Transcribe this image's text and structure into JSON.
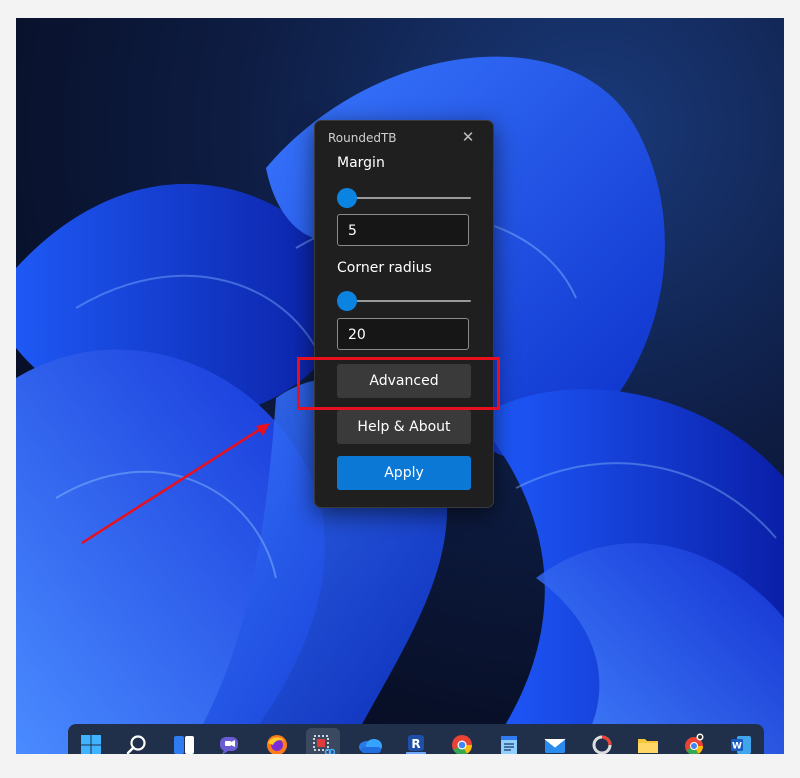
{
  "dialog": {
    "title": "RoundedTB",
    "close_icon": "close-icon",
    "margin_label": "Margin",
    "margin_value": "5",
    "margin_slider_fraction": 0.0,
    "corner_label": "Corner radius",
    "corner_value": "20",
    "corner_slider_fraction": 0.0,
    "advanced_label": "Advanced",
    "help_label": "Help & About",
    "apply_label": "Apply"
  },
  "colors": {
    "accent": "#0a78d4",
    "highlight": "#e8101f",
    "dialog_bg": "#1f1f1f"
  },
  "taskbar": {
    "icons": [
      {
        "name": "start-windows-icon"
      },
      {
        "name": "search-icon"
      },
      {
        "name": "widgets-icon"
      },
      {
        "name": "teams-chat-icon"
      },
      {
        "name": "firefox-icon"
      },
      {
        "name": "snipping-tool-icon",
        "active": true
      },
      {
        "name": "onedrive-icon"
      },
      {
        "name": "roundedtb-app-icon"
      },
      {
        "name": "chrome-icon"
      },
      {
        "name": "notepad-icon"
      },
      {
        "name": "mail-icon"
      },
      {
        "name": "app-icon"
      },
      {
        "name": "file-explorer-icon"
      },
      {
        "name": "chrome-profile-icon"
      },
      {
        "name": "word-icon"
      }
    ]
  }
}
